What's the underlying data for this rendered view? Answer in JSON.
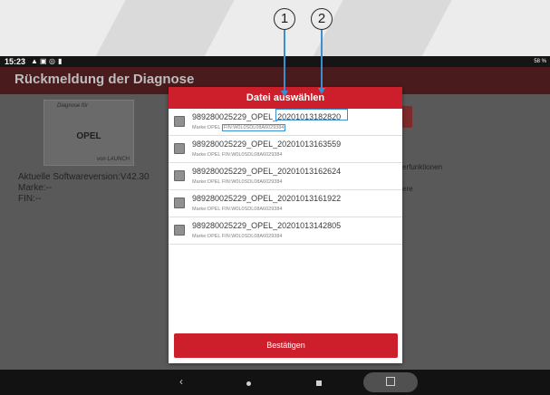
{
  "status_bar": {
    "time": "15:23",
    "icons": [
      "warning-icon",
      "image-icon",
      "settings-icon",
      "sd-card-icon"
    ],
    "battery": "58 %"
  },
  "app_bar": {
    "title": "Rückmeldung der Diagnose"
  },
  "card": {
    "top_label": "Diagnose für",
    "brand": "OPEL",
    "bottom_label": "von LAUNCH"
  },
  "info": {
    "software": "Aktuelle Softwareversion:V42.30",
    "make": "Marke:--",
    "vin": "FIN:--"
  },
  "background_right": {
    "line1": "erfunktionen",
    "line2": "ere"
  },
  "dialog": {
    "title": "Datei auswählen",
    "files": [
      {
        "name": "989280025229_OPEL_20201013182820",
        "make": "Marke:OPEL",
        "fin": "FIN:W0L0SDL08A6029384"
      },
      {
        "name": "989280025229_OPEL_20201013163559",
        "make": "Marke:OPEL",
        "fin": "FIN:W0L0SDL08A6029384"
      },
      {
        "name": "989280025229_OPEL_20201013162624",
        "make": "Marke:OPEL",
        "fin": "FIN:W0L0SDL08A6029384"
      },
      {
        "name": "989280025229_OPEL_20201013161922",
        "make": "Marke:OPEL",
        "fin": "FIN:W0L0SDL08A6029384"
      },
      {
        "name": "989280025229_OPEL_20201013142805",
        "make": "Marke:OPEL",
        "fin": "FIN:W0L0SDL08A6029384"
      }
    ],
    "confirm_label": "Bestätigen"
  },
  "callouts": {
    "one": "1",
    "two": "2"
  },
  "nav": {
    "back": "‹"
  },
  "colors": {
    "accent": "#cd1f2b",
    "highlight": "#3a8fd0"
  }
}
